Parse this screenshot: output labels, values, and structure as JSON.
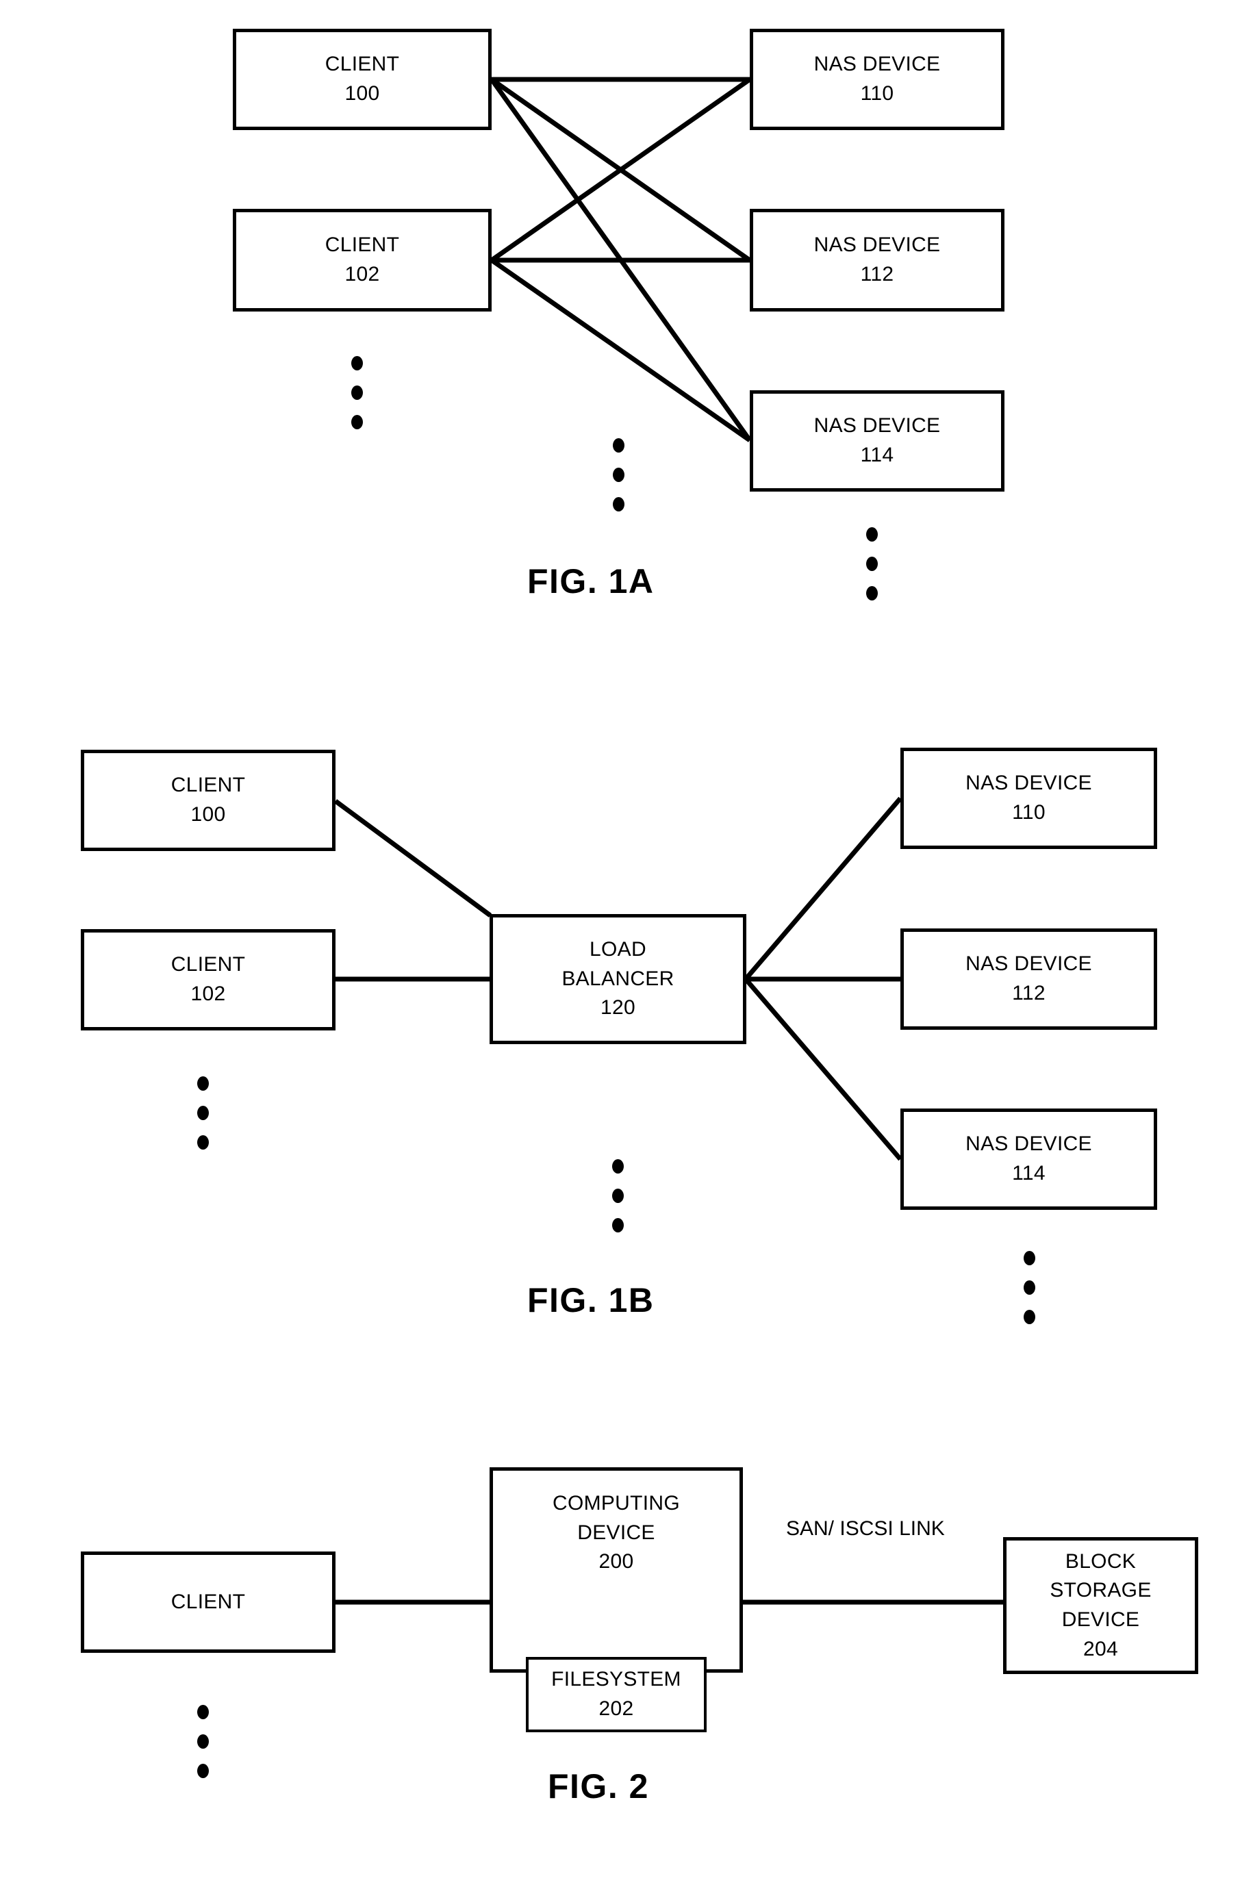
{
  "figures": [
    {
      "id": "fig1a",
      "label": "FIG. 1A",
      "nodes": {
        "client100": {
          "line1": "CLIENT",
          "line2": "100"
        },
        "client102": {
          "line1": "CLIENT",
          "line2": "102"
        },
        "nas110": {
          "line1": "NAS DEVICE",
          "line2": "110"
        },
        "nas112": {
          "line1": "NAS DEVICE",
          "line2": "112"
        },
        "nas114": {
          "line1": "NAS DEVICE",
          "line2": "114"
        }
      },
      "ellipsis": [
        "clients-more",
        "nas-more-mid",
        "nas-more-bottom"
      ]
    },
    {
      "id": "fig1b",
      "label": "FIG. 1B",
      "nodes": {
        "client100": {
          "line1": "CLIENT",
          "line2": "100"
        },
        "client102": {
          "line1": "CLIENT",
          "line2": "102"
        },
        "loadbalancer": {
          "line1": "LOAD",
          "line2": "BALANCER",
          "line3": "120"
        },
        "nas110": {
          "line1": "NAS DEVICE",
          "line2": "110"
        },
        "nas112": {
          "line1": "NAS DEVICE",
          "line2": "112"
        },
        "nas114": {
          "line1": "NAS DEVICE",
          "line2": "114"
        }
      },
      "ellipsis": [
        "clients-more",
        "center-more",
        "nas-more"
      ]
    },
    {
      "id": "fig2",
      "label": "FIG. 2",
      "nodes": {
        "client": {
          "line1": "CLIENT"
        },
        "computingdevice": {
          "line1": "COMPUTING",
          "line2": "DEVICE",
          "line3": "200"
        },
        "filesystem": {
          "line1": "FILESYSTEM",
          "line2": "202"
        },
        "blockstorage": {
          "line1": "BLOCK",
          "line2": "STORAGE",
          "line3": "DEVICE",
          "line4": "204"
        }
      },
      "link_label": {
        "line1": "SAN/",
        "line2": "ISCSI",
        "line3": "LINK"
      },
      "ellipsis": [
        "clients-more"
      ]
    }
  ],
  "style": {
    "stroke": "#000000",
    "fill": "#ffffff"
  }
}
